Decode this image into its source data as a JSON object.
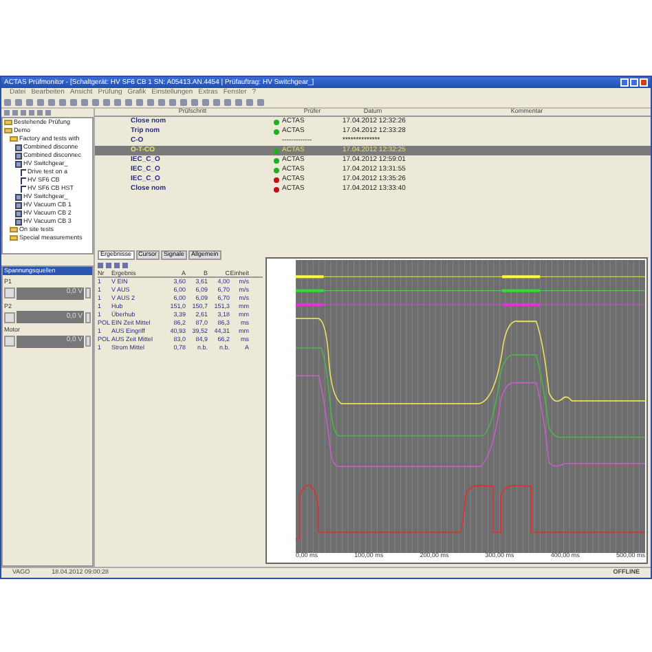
{
  "window": {
    "title": "ACTAS Prüfmonitor - [Schaltgerät: HV SF6 CB 1 SN: A05413.AN.4454 | Prüfauftrag: HV Switchgear_]"
  },
  "menu": [
    "Datei",
    "Bearbeiten",
    "Ansicht",
    "Prüfung",
    "Grafik",
    "Einstellungen",
    "Extras",
    "Fenster",
    "?"
  ],
  "tree": [
    {
      "label": "Bestehende Prüfung",
      "kind": "folder"
    },
    {
      "label": "Demo",
      "kind": "folder",
      "children": [
        {
          "label": "Factory and tests with",
          "kind": "folder",
          "children": [
            {
              "label": "Combined disconne",
              "kind": "device"
            },
            {
              "label": "Combined disconnec",
              "kind": "device"
            },
            {
              "label": "HV Switchgear_",
              "kind": "device",
              "children": [
                {
                  "label": "Drive test on a",
                  "kind": "test"
                },
                {
                  "label": "HV SF6 CB",
                  "kind": "test"
                },
                {
                  "label": "HV SF6 CB HST",
                  "kind": "test"
                }
              ]
            },
            {
              "label": "HV Switchgear_",
              "kind": "device"
            },
            {
              "label": "HV Vacuum CB 1",
              "kind": "device"
            },
            {
              "label": "HV Vacuum CB 2",
              "kind": "device"
            },
            {
              "label": "HV Vacuum CB 3",
              "kind": "device"
            }
          ]
        },
        {
          "label": "On site tests",
          "kind": "folder"
        },
        {
          "label": "Special measurements",
          "kind": "folder"
        }
      ]
    }
  ],
  "sources": {
    "title": "Spannungsquellen",
    "channels": [
      {
        "label": "P1",
        "value": "0,0 V"
      },
      {
        "label": "P2",
        "value": "0,0 V"
      },
      {
        "label": "Motor",
        "value": "0,0 V"
      }
    ]
  },
  "steps": {
    "columns": [
      "Prüfschritt",
      "Prüfer",
      "Datum",
      "Kommentar"
    ],
    "rows": [
      {
        "step": "Close nom",
        "tester": "ACTAS",
        "date": "17.04.2012 12:32:26",
        "color": "#20b020",
        "selected": false
      },
      {
        "step": "Trip nom",
        "tester": "ACTAS",
        "date": "17.04.2012 12:33:28",
        "color": "#20b020",
        "selected": false
      },
      {
        "step": "C-O",
        "tester": "-------------",
        "date": "**************",
        "selected": false
      },
      {
        "step": "O-T-CO",
        "tester": "ACTAS",
        "date": "17.04.2012 12:32:25",
        "color": "#20b020",
        "selected": true
      },
      {
        "step": "IEC_C_O",
        "tester": "ACTAS",
        "date": "17.04.2012 12:59:01",
        "color": "#20b020",
        "selected": false
      },
      {
        "step": "IEC_C_O",
        "tester": "ACTAS",
        "date": "17.04.2012 13:31:55",
        "color": "#20b020",
        "selected": false
      },
      {
        "step": "IEC_C_O",
        "tester": "ACTAS",
        "date": "17.04.2012 13:35:26",
        "color": "#c01010",
        "selected": false
      },
      {
        "step": "Close nom",
        "tester": "ACTAS",
        "date": "17.04.2012 13:33:40",
        "color": "#c01010",
        "selected": false
      }
    ]
  },
  "results": {
    "tabs": [
      {
        "label": "Ergebnisse",
        "selected": true
      },
      {
        "label": "Cursor",
        "selected": false
      },
      {
        "label": "Signale",
        "selected": false
      },
      {
        "label": "Allgemein",
        "selected": false
      }
    ],
    "columns": [
      "Nr",
      "Ergebnis",
      "A",
      "B",
      "C",
      "Einheit"
    ],
    "rows": [
      [
        "1",
        "V EIN",
        "3,60",
        "3,61",
        "4,00",
        "m/s"
      ],
      [
        "1",
        "V AUS",
        "6,00",
        "6,09",
        "6,70",
        "m/s"
      ],
      [
        "1",
        "V AUS 2",
        "6,00",
        "6,09",
        "6,70",
        "m/s"
      ],
      [
        "1",
        "Hub",
        "151,0",
        "150,7",
        "151,3",
        "mm"
      ],
      [
        "1",
        "Überhub",
        "3,39",
        "2,61",
        "3,18",
        "mm"
      ],
      [
        "POL",
        "EIN Zeit Mittel",
        "86,2",
        "87,0",
        "86,3",
        "ms"
      ],
      [
        "1",
        "AUS Eingriff",
        "40,93",
        "39,52",
        "44,31",
        "mm"
      ],
      [
        "POL",
        "AUS Zeit Mittel",
        "83,0",
        "84,9",
        "66,2",
        "ms"
      ],
      [
        "1",
        "Strom Mittel",
        "0,78",
        "n.b.",
        "n.b.",
        "A"
      ]
    ]
  },
  "graph": {
    "x_ticks": [
      "0,00 ms",
      "100,00 ms",
      "200,00 ms",
      "300,00 ms",
      "400,00 ms",
      "500,00 ms"
    ]
  },
  "status_bar": {
    "user": "VAGO",
    "date": "18.04.2012 09:00:28",
    "mode": "OFFLINE"
  }
}
